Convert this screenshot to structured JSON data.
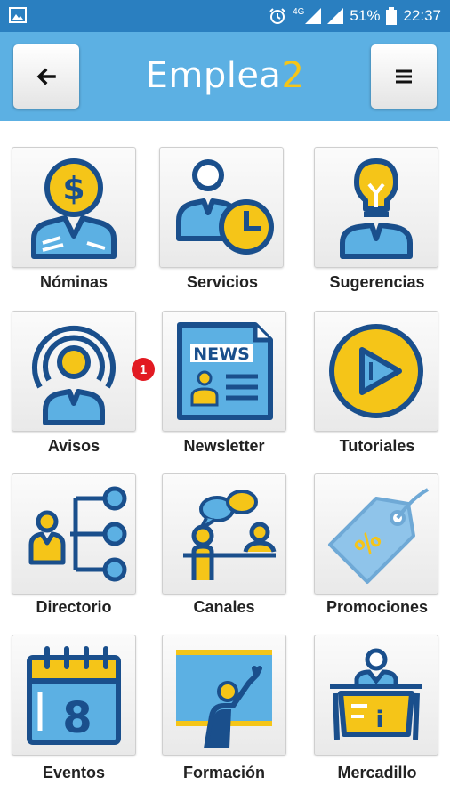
{
  "status": {
    "network": "4G",
    "battery": "51%",
    "time": "22:37"
  },
  "header": {
    "back_icon": "arrow-left-icon",
    "menu_icon": "hamburger-icon",
    "title_main": "Emplea",
    "title_accent": "2"
  },
  "colors": {
    "primary": "#5cb0e3",
    "status": "#2a7fc0",
    "icon_blue": "#1a4f8c",
    "icon_yellow": "#f5c518",
    "badge": "#e21a22"
  },
  "tiles": [
    {
      "label": "Nóminas"
    },
    {
      "label": "Servicios"
    },
    {
      "label": "Sugerencias"
    },
    {
      "label": "Avisos",
      "badge": "1"
    },
    {
      "label": "Newsletter"
    },
    {
      "label": "Tutoriales"
    },
    {
      "label": "Directorio"
    },
    {
      "label": "Canales"
    },
    {
      "label": "Promociones"
    },
    {
      "label": "Eventos"
    },
    {
      "label": "Formación"
    },
    {
      "label": "Mercadillo"
    }
  ],
  "icons": {
    "newsletter_text": "NEWS",
    "promo_text": "%",
    "eventos_text": "8",
    "mercadillo_text": "i"
  }
}
